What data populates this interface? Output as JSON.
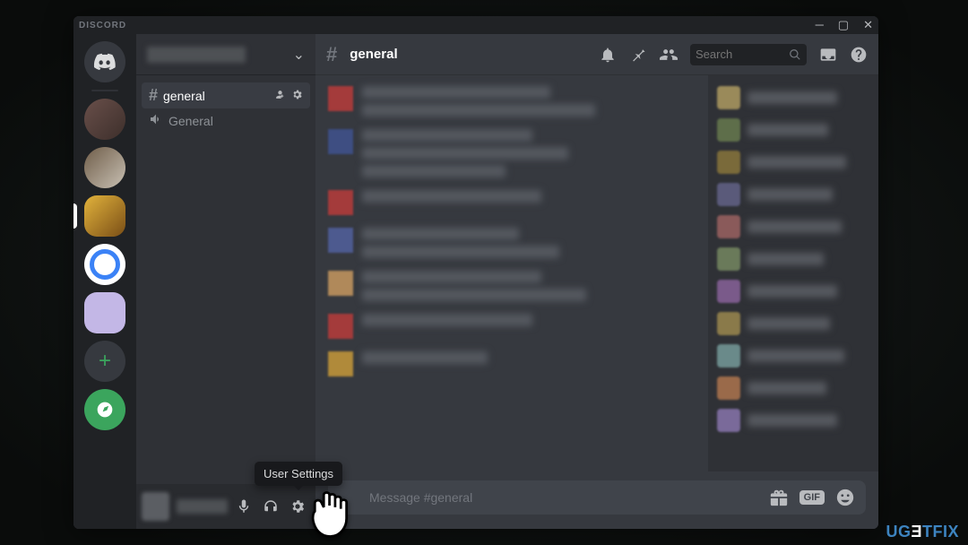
{
  "titlebar": {
    "brand": "DISCORD"
  },
  "server": {
    "dropdown_icon": "chevron-down"
  },
  "channels": {
    "text": {
      "name": "general",
      "hash": "#"
    },
    "voice": {
      "name": "General"
    }
  },
  "chat_header": {
    "hash": "#",
    "title": "general",
    "search_placeholder": "Search"
  },
  "message_input": {
    "placeholder": "Message #general",
    "gif_label": "GIF"
  },
  "tooltip": {
    "user_settings": "User Settings"
  },
  "watermark": "UGETFIX",
  "messages": [
    {
      "avatar": "#a43b3b",
      "lines": [
        210,
        260
      ]
    },
    {
      "avatar": "#3e4e82",
      "lines": [
        190,
        230,
        160
      ]
    },
    {
      "avatar": "#a43b3b",
      "lines": [
        200
      ]
    },
    {
      "avatar": "#4d5a8f",
      "lines": [
        175,
        220
      ]
    },
    {
      "avatar": "#b0895a",
      "lines": [
        200,
        250
      ]
    },
    {
      "avatar": "#a43b3b",
      "lines": [
        190
      ]
    },
    {
      "avatar": "#b08a3a",
      "lines": [
        140
      ]
    }
  ],
  "members": [
    {
      "avatar": "#9a8a5a",
      "w": 100
    },
    {
      "avatar": "#5e6e4a",
      "w": 90
    },
    {
      "avatar": "#7a6a3a",
      "w": 110
    },
    {
      "avatar": "#5a5a7a",
      "w": 95
    },
    {
      "avatar": "#8a5a5a",
      "w": 105
    },
    {
      "avatar": "#6a7a5a",
      "w": 85
    },
    {
      "avatar": "#7a5a8a",
      "w": 100
    },
    {
      "avatar": "#8a7a4a",
      "w": 92
    },
    {
      "avatar": "#6a8a8a",
      "w": 108
    },
    {
      "avatar": "#9a6a4a",
      "w": 88
    },
    {
      "avatar": "#7a6a9a",
      "w": 100
    }
  ]
}
